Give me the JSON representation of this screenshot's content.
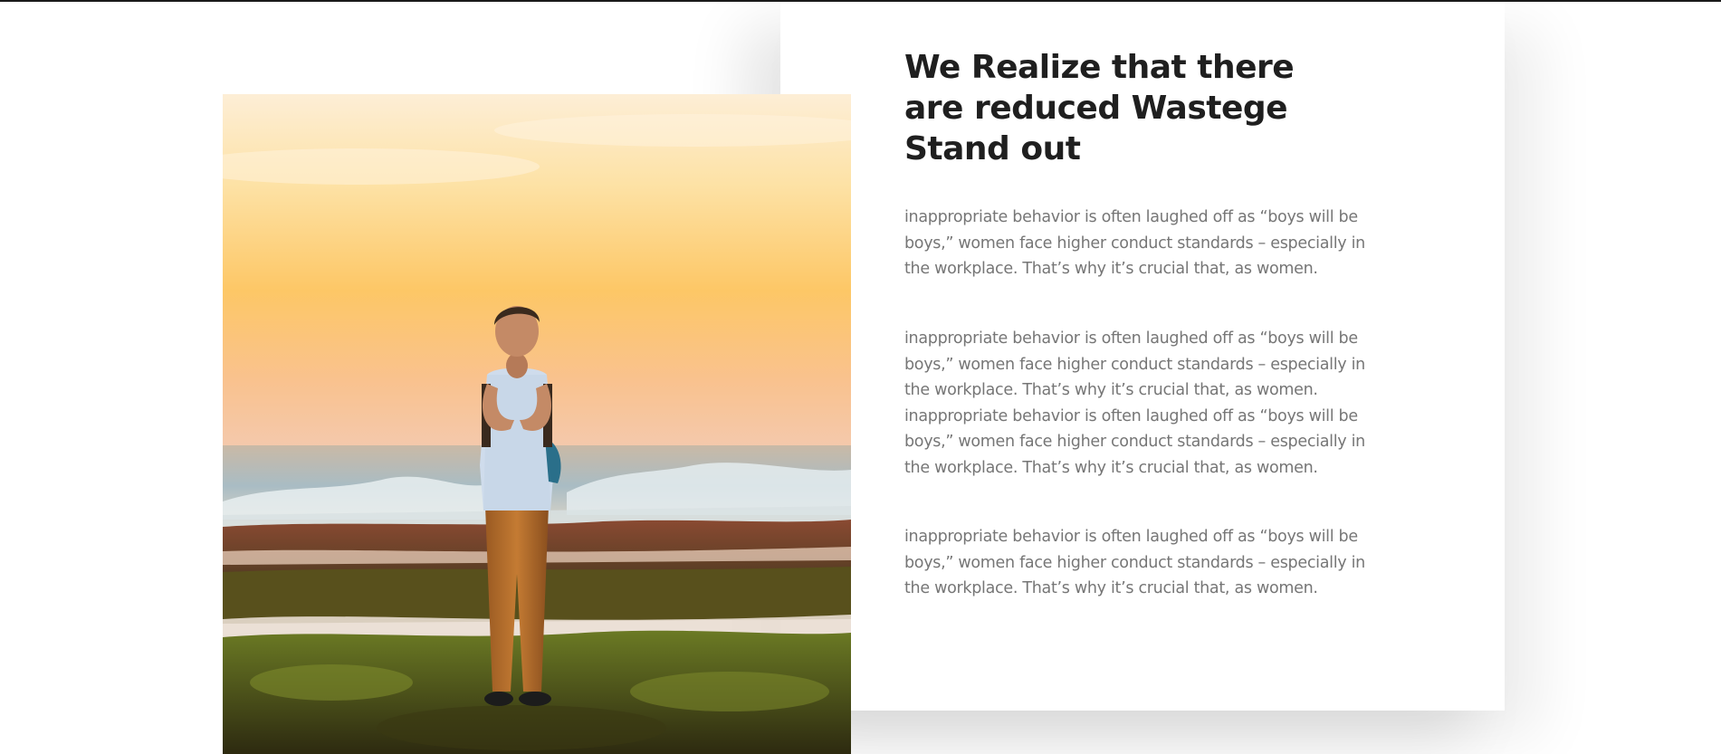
{
  "section": {
    "heading": "We Realize that there are reduced Wastege Stand out",
    "paragraphs": [
      "inappropriate behavior is often laughed off as “boys will be boys,” women face higher conduct standards – especially in the workplace. That’s why it’s crucial that, as women.",
      "inappropriate behavior is often laughed off as “boys will be boys,” women face higher conduct standards – especially in the workplace. That’s why it’s crucial that, as women. inappropriate behavior is often laughed off as “boys will be boys,” women face higher conduct standards – especially in the workplace. That’s why it’s crucial that, as women.",
      "inappropriate behavior is often laughed off as “boys will be boys,” women face higher conduct standards – especially in the workplace. That’s why it’s crucial that, as women."
    ]
  },
  "image": {
    "icon": "photo-man-on-beach-sunset",
    "colors": {
      "sky_top": "#fde9c4",
      "sky_mid": "#fdc55e",
      "sky_low": "#f8c08a",
      "sea": "#b9c7cf",
      "rocks": "#7a4a2e",
      "moss": "#5c6a1c"
    }
  },
  "colors": {
    "heading": "#1f1f1f",
    "body_text": "#767676",
    "top_border": "#1a1a1a"
  }
}
